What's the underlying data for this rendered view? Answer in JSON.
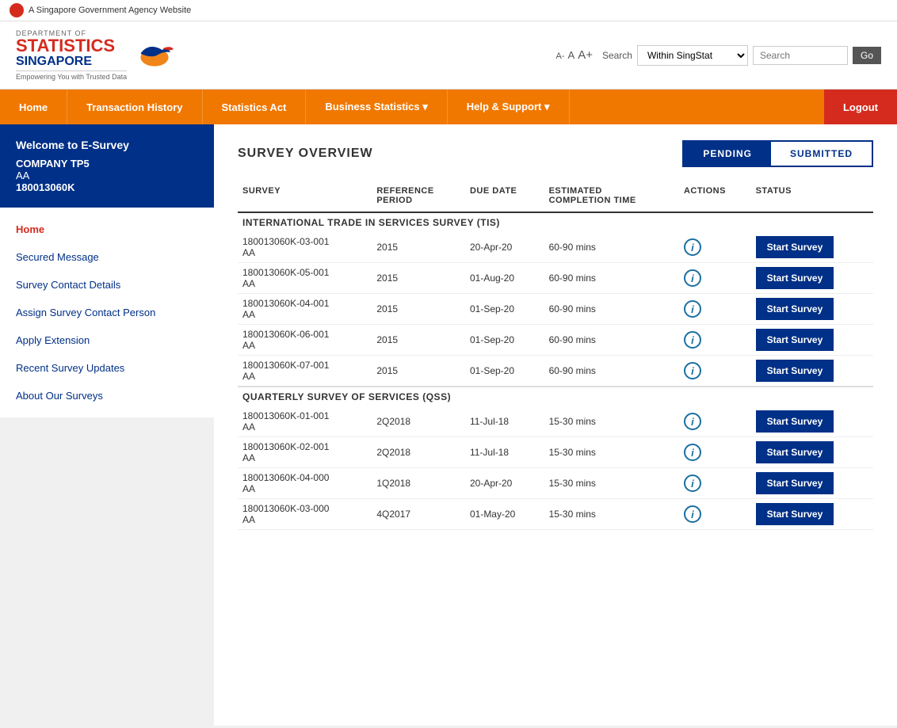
{
  "govBanner": {
    "text": "A Singapore Government Agency Website"
  },
  "logo": {
    "dept": "DEPARTMENT OF",
    "stats": "STATISTICS",
    "singapore": "SINGAPORE",
    "tagline": "Empowering You with Trusted Data"
  },
  "fontControls": {
    "small": "A-",
    "mid": "A",
    "large": "A+"
  },
  "search": {
    "label": "Search",
    "dropdown": "Within SingStat",
    "placeholder": "Search",
    "goLabel": "Go"
  },
  "nav": {
    "items": [
      {
        "label": "Home"
      },
      {
        "label": "Transaction History"
      },
      {
        "label": "Statistics Act"
      },
      {
        "label": "Business Statistics ▾"
      },
      {
        "label": "Help & Support ▾"
      }
    ],
    "logout": "Logout"
  },
  "sidebar": {
    "welcomeTitle": "Welcome to E-Survey",
    "company": "COMPANY TP5",
    "deptCode": "AA",
    "regNo": "180013060K",
    "navItems": [
      {
        "label": "Home",
        "active": true
      },
      {
        "label": "Secured Message",
        "active": false
      },
      {
        "label": "Survey Contact Details",
        "active": false
      },
      {
        "label": "Assign Survey Contact Person",
        "active": false
      },
      {
        "label": "Apply Extension",
        "active": false
      },
      {
        "label": "Recent Survey Updates",
        "active": false
      },
      {
        "label": "About Our Surveys",
        "active": false
      }
    ]
  },
  "content": {
    "title": "SURVEY OVERVIEW",
    "tabs": [
      {
        "label": "PENDING",
        "active": true
      },
      {
        "label": "SUBMITTED",
        "active": false
      }
    ],
    "tableHeaders": {
      "survey": "SURVEY",
      "referencePeriod": "REFERENCE PERIOD",
      "dueDate": "DUE DATE",
      "estimatedCompletionTime": "ESTIMATED COMPLETION TIME",
      "actions": "ACTIONS",
      "status": "STATUS"
    },
    "sections": [
      {
        "sectionTitle": "INTERNATIONAL TRADE IN SERVICES SURVEY (TIS)",
        "rows": [
          {
            "ref": "180013060K-03-001",
            "sub": "AA",
            "period": "2015",
            "dueDate": "20-Apr-20",
            "estTime": "60-90 mins",
            "btnLabel": "Start Survey"
          },
          {
            "ref": "180013060K-05-001",
            "sub": "AA",
            "period": "2015",
            "dueDate": "01-Aug-20",
            "estTime": "60-90 mins",
            "btnLabel": "Start Survey"
          },
          {
            "ref": "180013060K-04-001",
            "sub": "AA",
            "period": "2015",
            "dueDate": "01-Sep-20",
            "estTime": "60-90 mins",
            "btnLabel": "Start Survey"
          },
          {
            "ref": "180013060K-06-001",
            "sub": "AA",
            "period": "2015",
            "dueDate": "01-Sep-20",
            "estTime": "60-90 mins",
            "btnLabel": "Start Survey"
          },
          {
            "ref": "180013060K-07-001",
            "sub": "AA",
            "period": "2015",
            "dueDate": "01-Sep-20",
            "estTime": "60-90 mins",
            "btnLabel": "Start Survey"
          }
        ]
      },
      {
        "sectionTitle": "QUARTERLY SURVEY OF SERVICES (QSS)",
        "rows": [
          {
            "ref": "180013060K-01-001",
            "sub": "AA",
            "period": "2Q2018",
            "dueDate": "11-Jul-18",
            "estTime": "15-30 mins",
            "btnLabel": "Start Survey"
          },
          {
            "ref": "180013060K-02-001",
            "sub": "AA",
            "period": "2Q2018",
            "dueDate": "11-Jul-18",
            "estTime": "15-30 mins",
            "btnLabel": "Start Survey"
          },
          {
            "ref": "180013060K-04-000",
            "sub": "AA",
            "period": "1Q2018",
            "dueDate": "20-Apr-20",
            "estTime": "15-30 mins",
            "btnLabel": "Start Survey"
          },
          {
            "ref": "180013060K-03-000",
            "sub": "AA",
            "period": "4Q2017",
            "dueDate": "01-May-20",
            "estTime": "15-30 mins",
            "btnLabel": "Start Survey"
          }
        ]
      }
    ]
  }
}
